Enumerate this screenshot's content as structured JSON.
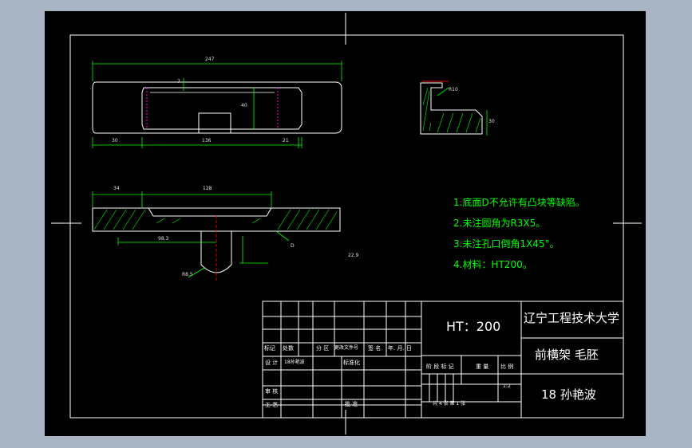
{
  "drawing": {
    "notes": [
      "1.底面D不允许有凸块等缺陷。",
      "2.未注圆角为R3X5。",
      "3.未注孔口倒角1X45°。",
      "4.材料：HT200。"
    ],
    "dimensions": {
      "top_length": "247",
      "top_left": "30",
      "top_mid": "136",
      "top_right": "21",
      "top_height": "40",
      "top_small": "7",
      "sec_left": "34",
      "sec_mid": "128",
      "sec_center": "98.3",
      "sec_radius": "R8.5",
      "sec_height": "22.9",
      "sec_mark": "D",
      "side_radius": "R10",
      "side_height": "30"
    }
  },
  "title_block": {
    "material": "HT：200",
    "school": "辽宁工程技术大学",
    "part_name": "前横架  毛胚",
    "author": "18 孙艳波",
    "col_labels": [
      "标记",
      "处数",
      "分 区",
      "更改文件号",
      "签 名",
      "年. 月. 日"
    ],
    "design_label": "设 计",
    "designer_tag": "18孙艳波",
    "standardize_label": "标准化",
    "stage_headers": [
      "阶 段 标 记",
      "重 量",
      "比 例"
    ],
    "scale_value": "1:2",
    "review_label": "审 核",
    "process_label": "工 艺",
    "approve_label": "批 准",
    "sheets": "共 4  张    第  1 张"
  }
}
